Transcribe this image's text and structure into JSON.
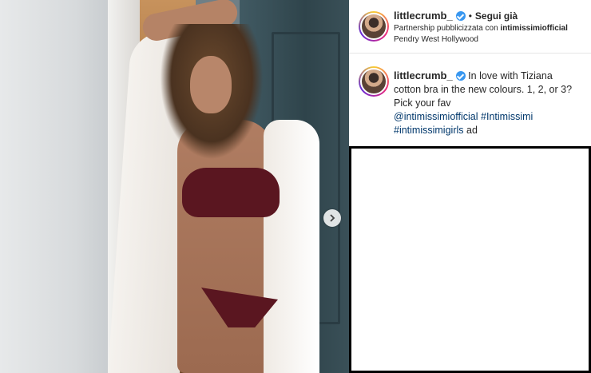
{
  "post": {
    "photo_alt": "photo",
    "next_icon": "chevron-right-icon"
  },
  "header": {
    "username": "littlecrumb_",
    "separator": "•",
    "follow_label": "Segui già",
    "partnership_prefix": "Partnership pubblicizzata con ",
    "partner_name": "intimissimiofficial",
    "location": "Pendry West Hollywood"
  },
  "caption": {
    "username": "littlecrumb_",
    "text": "In love with Tiziana cotton bra in the new colours. 1, 2, or 3? Pick your fav",
    "mention": "@intimissimiofficial",
    "hashtag1": "#Intimissimi",
    "hashtag2": "#intimissimigirls",
    "suffix": "ad"
  },
  "colors": {
    "verified": "#3897f0",
    "link": "#00376b"
  }
}
